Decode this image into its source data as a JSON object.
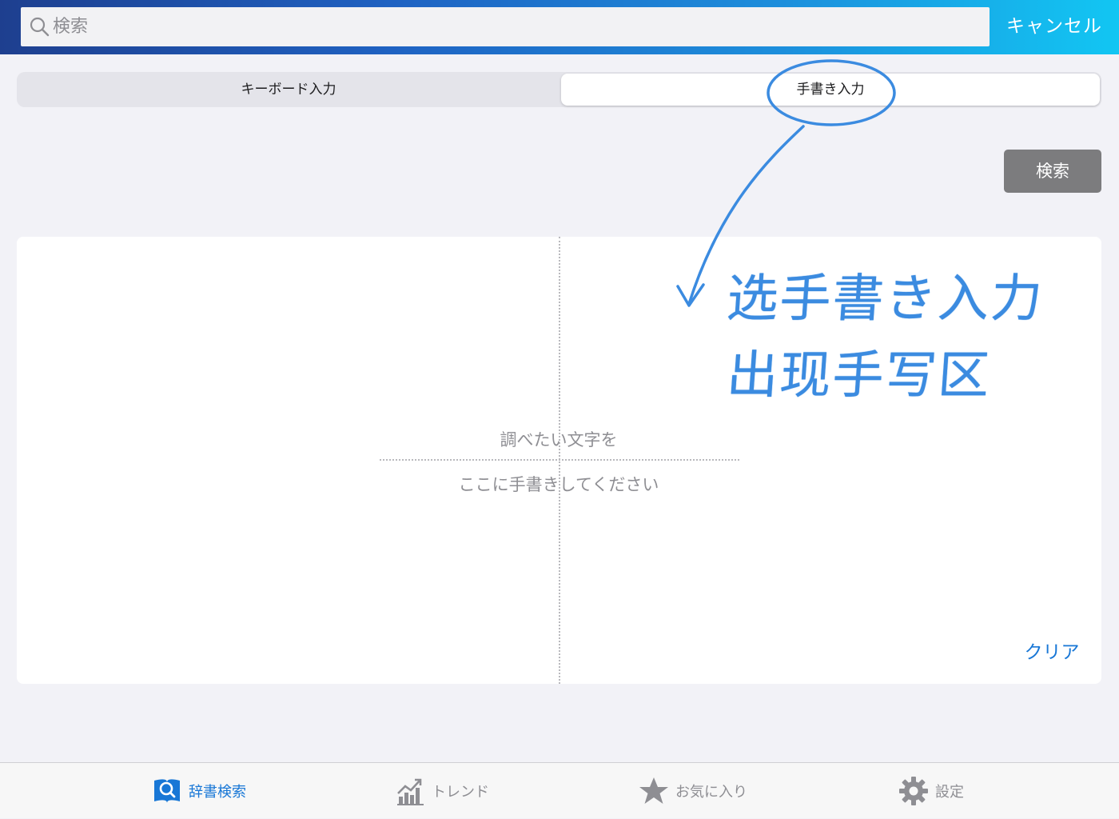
{
  "header": {
    "search_placeholder": "検索",
    "cancel_label": "キャンセル"
  },
  "input_mode": {
    "tabs": [
      {
        "label": "キーボード入力",
        "selected": false
      },
      {
        "label": "手書き入力",
        "selected": true
      }
    ]
  },
  "search_button_label": "検索",
  "canvas": {
    "hint_line_1": "調べたい文字を",
    "hint_line_2": "ここに手書きしてください",
    "clear_label": "クリア"
  },
  "annotation": {
    "line_1": "选手書き入力",
    "line_2": "出现手写区",
    "color": "#3b8be0"
  },
  "tabbar": {
    "items": [
      {
        "label": "辞書検索",
        "icon": "dictionary-search-icon",
        "active": true
      },
      {
        "label": "トレンド",
        "icon": "trend-chart-icon",
        "active": false
      },
      {
        "label": "お気に入り",
        "icon": "star-icon",
        "active": false
      },
      {
        "label": "設定",
        "icon": "gear-icon",
        "active": false
      }
    ],
    "active_color": "#1877d6",
    "inactive_color": "#8e8e93"
  }
}
